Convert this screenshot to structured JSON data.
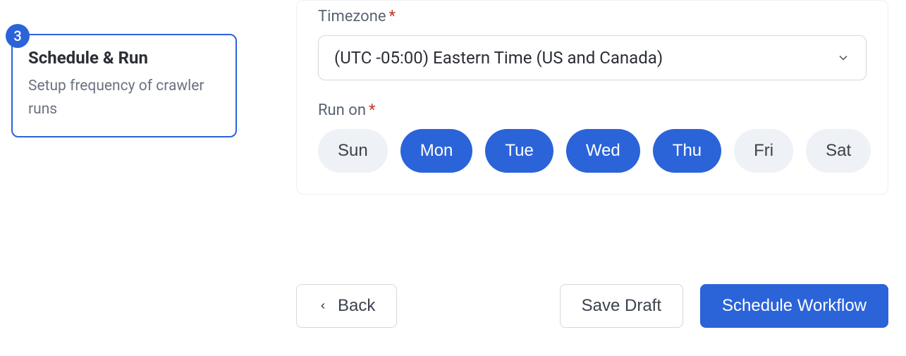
{
  "sidebar": {
    "step_number": "3",
    "title": "Schedule & Run",
    "subtitle": "Setup frequency of crawler runs"
  },
  "form": {
    "timezone_label": "Timezone",
    "timezone_value": "(UTC -05:00) Eastern Time (US and Canada)",
    "run_on_label": "Run on",
    "days": [
      {
        "label": "Sun",
        "selected": false
      },
      {
        "label": "Mon",
        "selected": true
      },
      {
        "label": "Tue",
        "selected": true
      },
      {
        "label": "Wed",
        "selected": true
      },
      {
        "label": "Thu",
        "selected": true
      },
      {
        "label": "Fri",
        "selected": false
      },
      {
        "label": "Sat",
        "selected": false
      }
    ]
  },
  "footer": {
    "back_label": "Back",
    "save_draft_label": "Save Draft",
    "schedule_label": "Schedule Workflow"
  }
}
